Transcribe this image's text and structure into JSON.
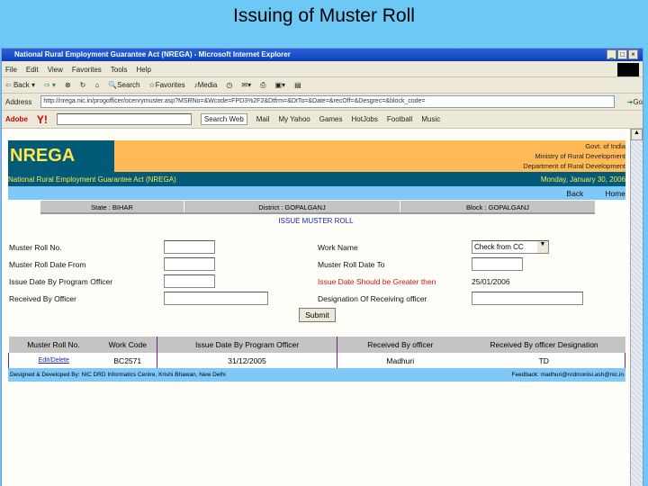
{
  "slide_title": "Issuing of Muster Roll",
  "window": {
    "title": "National Rural Employment Guarantee Act (NREGA) - Microsoft Internet Explorer"
  },
  "menu": [
    "File",
    "Edit",
    "View",
    "Favorites",
    "Tools",
    "Help"
  ],
  "toolbar": {
    "back": "Back",
    "search": "Search",
    "favorites": "Favorites",
    "media": "Media"
  },
  "address": {
    "label": "Address",
    "url": "http://nrega.nic.in/progofficer/ocenrymuster.asp?MSRNo=&Wcode=FPD3%2F2&Dtfrm=&DtTo=&Date=&recOff=&Desgrec=&block_code=",
    "go": "Go"
  },
  "links_bar": {
    "adobe": "Adobe",
    "search_web": "Search Web",
    "mail": "Mail",
    "my_yahoo": "My Yahoo",
    "games": "Games",
    "hotjobs": "HotJobs",
    "football": "Football",
    "music": "Music"
  },
  "header": {
    "logo": "NREGA",
    "gov": "Govt. of India",
    "ministry": "Ministry of Rural Development",
    "department": "Department of Rural Development",
    "act": "National Rural Employment Guarantee Act (NREGA)",
    "date": "Monday, January 30, 2006",
    "back": "Back",
    "home": "Home"
  },
  "location": {
    "state": "State : BIHAR",
    "district": "District : GOPALGANJ",
    "block": "Block : GOPALGANJ"
  },
  "section_title": "ISSUE MUSTER ROLL",
  "form": {
    "muster_roll_no": "Muster Roll No.",
    "date_from": "Muster Roll Date From",
    "issue_date": "Issue Date By Program Officer",
    "received_by": "Received By Officer",
    "work_name": "Work Name",
    "work_name_value": "Check from CC",
    "date_to": "Muster Roll Date To",
    "warning": "Issue Date Should be Greater then",
    "warning_date": "25/01/2006",
    "designation": "Designation Of Receiving officer",
    "submit": "Submit"
  },
  "table": {
    "headers": [
      "Muster Roll No.",
      "Work Code",
      "Issue Date By Program Officer",
      "Received By officer",
      "Received By officer Designation"
    ],
    "rows": [
      {
        "edit": "Edit",
        "delete": "Delete",
        "work_code": "BC2571",
        "issue_date": "31/12/2005",
        "received_by": "Madhuri",
        "designation": "TD"
      }
    ]
  },
  "footer": {
    "left": "Designed & Developed By: NIC DRD Informatics Centre, Krishi Bhawan, New Delhi",
    "right": "Feedback: madhuri@nrdmonisi.ash@nic.in"
  },
  "colors": {
    "teal": "#005a78",
    "orange": "#ffb957",
    "light_blue": "#80c8f8",
    "slide_bg": "#6cc8f4"
  }
}
